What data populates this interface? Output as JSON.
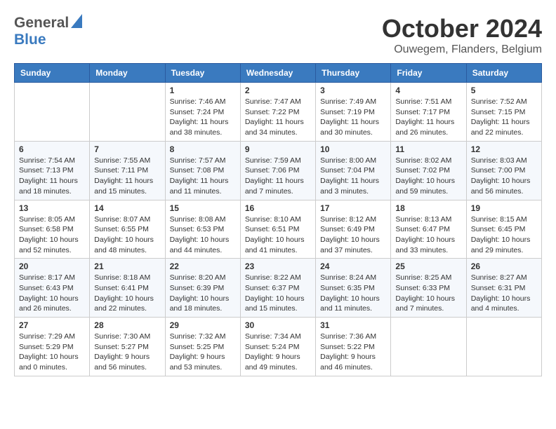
{
  "header": {
    "logo_general": "General",
    "logo_blue": "Blue",
    "month_title": "October 2024",
    "location": "Ouwegem, Flanders, Belgium"
  },
  "weekdays": [
    "Sunday",
    "Monday",
    "Tuesday",
    "Wednesday",
    "Thursday",
    "Friday",
    "Saturday"
  ],
  "weeks": [
    [
      {
        "day": "",
        "info": ""
      },
      {
        "day": "",
        "info": ""
      },
      {
        "day": "1",
        "info": "Sunrise: 7:46 AM\nSunset: 7:24 PM\nDaylight: 11 hours and 38 minutes."
      },
      {
        "day": "2",
        "info": "Sunrise: 7:47 AM\nSunset: 7:22 PM\nDaylight: 11 hours and 34 minutes."
      },
      {
        "day": "3",
        "info": "Sunrise: 7:49 AM\nSunset: 7:19 PM\nDaylight: 11 hours and 30 minutes."
      },
      {
        "day": "4",
        "info": "Sunrise: 7:51 AM\nSunset: 7:17 PM\nDaylight: 11 hours and 26 minutes."
      },
      {
        "day": "5",
        "info": "Sunrise: 7:52 AM\nSunset: 7:15 PM\nDaylight: 11 hours and 22 minutes."
      }
    ],
    [
      {
        "day": "6",
        "info": "Sunrise: 7:54 AM\nSunset: 7:13 PM\nDaylight: 11 hours and 18 minutes."
      },
      {
        "day": "7",
        "info": "Sunrise: 7:55 AM\nSunset: 7:11 PM\nDaylight: 11 hours and 15 minutes."
      },
      {
        "day": "8",
        "info": "Sunrise: 7:57 AM\nSunset: 7:08 PM\nDaylight: 11 hours and 11 minutes."
      },
      {
        "day": "9",
        "info": "Sunrise: 7:59 AM\nSunset: 7:06 PM\nDaylight: 11 hours and 7 minutes."
      },
      {
        "day": "10",
        "info": "Sunrise: 8:00 AM\nSunset: 7:04 PM\nDaylight: 11 hours and 3 minutes."
      },
      {
        "day": "11",
        "info": "Sunrise: 8:02 AM\nSunset: 7:02 PM\nDaylight: 10 hours and 59 minutes."
      },
      {
        "day": "12",
        "info": "Sunrise: 8:03 AM\nSunset: 7:00 PM\nDaylight: 10 hours and 56 minutes."
      }
    ],
    [
      {
        "day": "13",
        "info": "Sunrise: 8:05 AM\nSunset: 6:58 PM\nDaylight: 10 hours and 52 minutes."
      },
      {
        "day": "14",
        "info": "Sunrise: 8:07 AM\nSunset: 6:55 PM\nDaylight: 10 hours and 48 minutes."
      },
      {
        "day": "15",
        "info": "Sunrise: 8:08 AM\nSunset: 6:53 PM\nDaylight: 10 hours and 44 minutes."
      },
      {
        "day": "16",
        "info": "Sunrise: 8:10 AM\nSunset: 6:51 PM\nDaylight: 10 hours and 41 minutes."
      },
      {
        "day": "17",
        "info": "Sunrise: 8:12 AM\nSunset: 6:49 PM\nDaylight: 10 hours and 37 minutes."
      },
      {
        "day": "18",
        "info": "Sunrise: 8:13 AM\nSunset: 6:47 PM\nDaylight: 10 hours and 33 minutes."
      },
      {
        "day": "19",
        "info": "Sunrise: 8:15 AM\nSunset: 6:45 PM\nDaylight: 10 hours and 29 minutes."
      }
    ],
    [
      {
        "day": "20",
        "info": "Sunrise: 8:17 AM\nSunset: 6:43 PM\nDaylight: 10 hours and 26 minutes."
      },
      {
        "day": "21",
        "info": "Sunrise: 8:18 AM\nSunset: 6:41 PM\nDaylight: 10 hours and 22 minutes."
      },
      {
        "day": "22",
        "info": "Sunrise: 8:20 AM\nSunset: 6:39 PM\nDaylight: 10 hours and 18 minutes."
      },
      {
        "day": "23",
        "info": "Sunrise: 8:22 AM\nSunset: 6:37 PM\nDaylight: 10 hours and 15 minutes."
      },
      {
        "day": "24",
        "info": "Sunrise: 8:24 AM\nSunset: 6:35 PM\nDaylight: 10 hours and 11 minutes."
      },
      {
        "day": "25",
        "info": "Sunrise: 8:25 AM\nSunset: 6:33 PM\nDaylight: 10 hours and 7 minutes."
      },
      {
        "day": "26",
        "info": "Sunrise: 8:27 AM\nSunset: 6:31 PM\nDaylight: 10 hours and 4 minutes."
      }
    ],
    [
      {
        "day": "27",
        "info": "Sunrise: 7:29 AM\nSunset: 5:29 PM\nDaylight: 10 hours and 0 minutes."
      },
      {
        "day": "28",
        "info": "Sunrise: 7:30 AM\nSunset: 5:27 PM\nDaylight: 9 hours and 56 minutes."
      },
      {
        "day": "29",
        "info": "Sunrise: 7:32 AM\nSunset: 5:25 PM\nDaylight: 9 hours and 53 minutes."
      },
      {
        "day": "30",
        "info": "Sunrise: 7:34 AM\nSunset: 5:24 PM\nDaylight: 9 hours and 49 minutes."
      },
      {
        "day": "31",
        "info": "Sunrise: 7:36 AM\nSunset: 5:22 PM\nDaylight: 9 hours and 46 minutes."
      },
      {
        "day": "",
        "info": ""
      },
      {
        "day": "",
        "info": ""
      }
    ]
  ]
}
